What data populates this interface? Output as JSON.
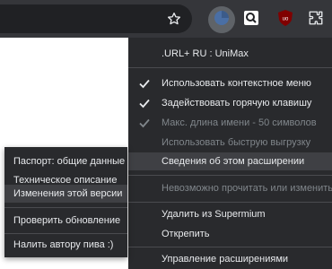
{
  "toolbar": {
    "icons": [
      "star-icon",
      "unimax-extension-icon",
      "screenshot-extension-icon",
      "ublock-origin-icon",
      "extensions-puzzle-icon"
    ]
  },
  "context_menu": {
    "header": ".URL+ RU : UniMax",
    "items": [
      {
        "label": "Использовать контекстное меню",
        "checked": true,
        "disabled": false
      },
      {
        "label": "Задействовать горячую клавишу",
        "checked": true,
        "disabled": false
      },
      {
        "label": "Макс. длина имени - 50 символов",
        "checked": true,
        "disabled": true
      },
      {
        "label": "Использовать быструю выгрузку",
        "checked": false,
        "disabled": true
      }
    ],
    "about": "Сведения об этом расширении",
    "cannot_read": "Невозможно прочитать или изменить",
    "remove": "Удалить из Supermium",
    "unpin": "Открепить",
    "manage": "Управление расширениями"
  },
  "submenu": {
    "items": [
      "Паспорт: общие данные",
      "Техническое описание",
      "Изменения этой версии",
      "Проверить обновление",
      "Налить автору пива :)"
    ]
  },
  "colors": {
    "menu_bg": "#292a2d",
    "highlight": "#3f4044",
    "text": "#e8eaed",
    "disabled_text": "#80868b",
    "ublock_red": "#800000"
  }
}
